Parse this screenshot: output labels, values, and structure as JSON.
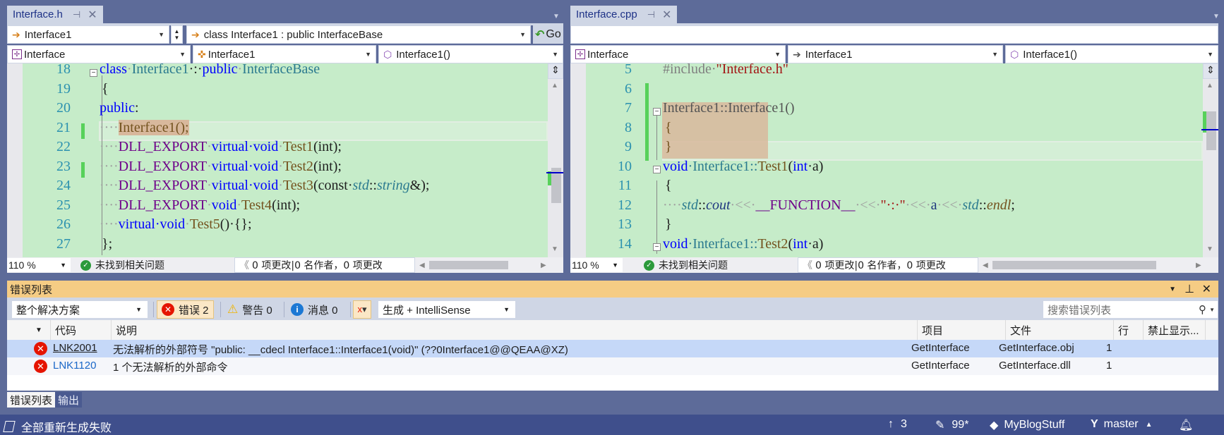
{
  "left_editor": {
    "tab": {
      "title": "Interface.h",
      "pin_icon": "pin-icon",
      "close_icon": "close-icon"
    },
    "nav1": {
      "scope": "Interface1",
      "member": "class Interface1 : public InterfaceBase",
      "go_label": "Go"
    },
    "nav2": {
      "project": "Interface",
      "class": "Interface1",
      "function": "Interface1()"
    },
    "lines": [
      {
        "n": "18"
      },
      {
        "n": "19"
      },
      {
        "n": "20"
      },
      {
        "n": "21"
      },
      {
        "n": "22"
      },
      {
        "n": "23"
      },
      {
        "n": "24"
      },
      {
        "n": "25"
      },
      {
        "n": "26"
      },
      {
        "n": "27"
      }
    ],
    "code": {
      "l18_kw": "class",
      "l18_name": "Interface1",
      "l18_colon": "·:·",
      "l18_pub": "public",
      "l18_base": "InterfaceBase",
      "l19": "{",
      "l20_kw": "public",
      "l20_colon": ":",
      "l21_ws": "····",
      "l21_fn": "Interface1();",
      "l22_ws": "····",
      "l22_mac": "DLL_EXPORT",
      "l22_kw": "virtual·void",
      "l22_fn": "Test1",
      "l22_rest": "(int);",
      "l23_ws": "····",
      "l23_mac": "DLL_EXPORT",
      "l23_kw": "virtual·void",
      "l23_fn": "Test2",
      "l23_rest": "(int);",
      "l24_ws": "····",
      "l24_mac": "DLL_EXPORT",
      "l24_kw": "virtual·void",
      "l24_fn": "Test3",
      "l24_p1": "(const·",
      "l24_std": "std",
      "l24_sep": "::",
      "l24_str": "string",
      "l24_rest": "&);",
      "l25_ws": "····",
      "l25_mac": "DLL_EXPORT",
      "l25_kw": "void",
      "l25_fn": "Test4",
      "l25_rest": "(int);",
      "l26_ws": "····",
      "l26_kw": "virtual·void",
      "l26_fn": "Test5",
      "l26_rest": "()·{};",
      "l27": "};"
    },
    "status": {
      "zoom": "110 %",
      "issues": "未找到相关问题",
      "changes": "0 项更改|0 名作者，0 项更改"
    }
  },
  "right_editor": {
    "tab": {
      "title": "Interface.cpp",
      "pin_icon": "pin-icon",
      "close_icon": "close-icon"
    },
    "nav2": {
      "project": "Interface",
      "class": "Interface1",
      "function": "Interface1()"
    },
    "lines": [
      {
        "n": "5"
      },
      {
        "n": "6"
      },
      {
        "n": "7"
      },
      {
        "n": "8"
      },
      {
        "n": "9"
      },
      {
        "n": "10"
      },
      {
        "n": "11"
      },
      {
        "n": "12"
      },
      {
        "n": "13"
      },
      {
        "n": "14"
      }
    ],
    "code": {
      "l5_pp": "#include·",
      "l5_str": "\"Interface.h\"",
      "l7": "Interface1::Interface1()",
      "l8": "{",
      "l9": "}",
      "l10_kw": "void",
      "l10_cls": "·Interface1::",
      "l10_fn": "Test1",
      "l10_p": "(",
      "l10_int": "int",
      "l10_rest": "·a)",
      "l11": "{",
      "l12_ws": "····",
      "l12_std": "std",
      "l12_sep": "::",
      "l12_cout": "cout",
      "l12_op1": "·<<·",
      "l12_mac": "__FUNCTION__",
      "l12_op2": "·<<·",
      "l12_str": "\"·:·\"",
      "l12_op3": "·<<·",
      "l12_a": "a",
      "l12_op4": "·<<·",
      "l12_std2": "std",
      "l12_sep2": "::",
      "l12_endl": "endl",
      "l12_end": ";",
      "l13": "}",
      "l14_kw": "void",
      "l14_cls": "·Interface1::",
      "l14_fn": "Test2",
      "l14_p": "(",
      "l14_int": "int",
      "l14_rest": "·a)"
    },
    "status": {
      "zoom": "110 %",
      "issues": "未找到相关问题",
      "changes": "0 项更改|0 名作者，0 项更改"
    }
  },
  "error_list": {
    "title": "错误列表",
    "scope": "整个解决方案",
    "errors_label": "错误 2",
    "warnings_label": "警告 0",
    "messages_label": "消息 0",
    "source": "生成 + IntelliSense",
    "search_placeholder": "搜索错误列表",
    "columns": [
      "代码",
      "说明",
      "项目",
      "文件",
      "行",
      "禁止显示..."
    ],
    "rows": [
      {
        "code": "LNK2001",
        "desc": "无法解析的外部符号 \"public: __cdecl Interface1::Interface1(void)\" (??0Interface1@@QEAA@XZ)",
        "project": "GetInterface",
        "file": "GetInterface.obj",
        "line": "1",
        "suppress": ""
      },
      {
        "code": "LNK1120",
        "desc": "1 个无法解析的外部命令",
        "project": "GetInterface",
        "file": "GetInterface.dll",
        "line": "1",
        "suppress": ""
      }
    ],
    "tabs": [
      "错误列表",
      "输出"
    ]
  },
  "status_bar": {
    "message": "全部重新生成失败",
    "push": "3",
    "pending": "99*",
    "repo": "MyBlogStuff",
    "branch": "master"
  },
  "colors": {
    "accent_panel": "#f5cc84",
    "editor_bg": "#c6ecc9",
    "status_bar": "#3f4f8c",
    "error": "#e51400"
  }
}
